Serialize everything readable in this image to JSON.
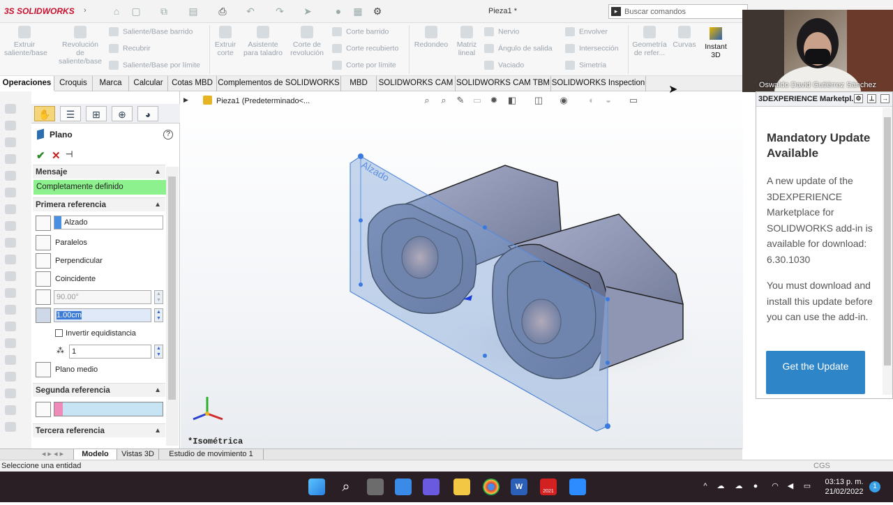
{
  "app": {
    "logo_prefix": "3S",
    "logo_name": "SOLIDWORKS",
    "document_title": "Pieza1 *",
    "search_placeholder": "Buscar comandos"
  },
  "ribbon": {
    "extrude_boss": "Extruir saliente/base",
    "revolve_boss": "Revolución de saliente/base",
    "swept_boss": "Saliente/Base barrido",
    "loft": "Recubrir",
    "boundary_boss": "Saliente/Base por límite",
    "extrude_cut": "Extruir corte",
    "hole_wizard": "Asistente para taladro",
    "revolve_cut": "Corte de revolución",
    "swept_cut": "Corte barrido",
    "lofted_cut": "Corte recubierto",
    "boundary_cut": "Corte por límite",
    "fillet": "Redondeo",
    "linear_pattern": "Matriz lineal",
    "rib": "Nervio",
    "draft": "Ángulo de salida",
    "shell": "Vaciado",
    "wrap": "Envolver",
    "intersect": "Intersección",
    "mirror": "Simetría",
    "ref_geometry": "Geometría de refer...",
    "curves": "Curvas",
    "instant3d": "Instant 3D"
  },
  "tabs": [
    "Operaciones",
    "Croquis",
    "Marca",
    "Calcular",
    "Cotas MBD",
    "Complementos de SOLIDWORKS",
    "MBD",
    "SOLIDWORKS CAM",
    "SOLIDWORKS CAM TBM",
    "SOLIDWORKS Inspection"
  ],
  "property_manager": {
    "title": "Plano",
    "help": "?",
    "message_header": "Mensaje",
    "message": "Completamente definido",
    "first_ref_header": "Primera referencia",
    "first_ref_value": "Alzado",
    "parallel": "Paralelos",
    "perpendicular": "Perpendicular",
    "coincident": "Coincidente",
    "angle_value": "90.00°",
    "offset_value": "1.00cm",
    "flip_offset": "Invertir equidistancia",
    "count_value": "1",
    "mid_plane": "Plano medio",
    "second_ref_header": "Segunda referencia",
    "third_ref_header": "Tercera referencia"
  },
  "viewport": {
    "tree_label": "Pieza1  (Predeterminado<...",
    "plane_label": "Alzado",
    "view_label": "*Isométrica"
  },
  "bottom_tabs": [
    "Modelo",
    "Vistas 3D",
    "Estudio de movimiento 1"
  ],
  "status": {
    "left": "Seleccione una entidad",
    "right": "CGS"
  },
  "webcam": {
    "name": "Oswaldo David Gutiérrez Sánchez"
  },
  "marketplace": {
    "header": "3DEXPERIENCE Marketpl...",
    "title": "Mandatory Update Available",
    "para1": "A new update of the 3DEXPERIENCE Marketplace for SOLIDWORKS add-in is available for download: 6.30.1030",
    "para2": "You must download and install this update before you can use the add-in.",
    "button": "Get the Update"
  },
  "taskbar": {
    "time": "03:13 p. m.",
    "date": "21/02/2022",
    "notifications": "1",
    "solidworks_badge": "2021"
  },
  "colors": {
    "message_bg": "#8df28d",
    "plane_fill": "#7aa0d6",
    "model_body": "#8b93b4",
    "update_button": "#2e86c8",
    "taskbar": "#2a1f24"
  }
}
